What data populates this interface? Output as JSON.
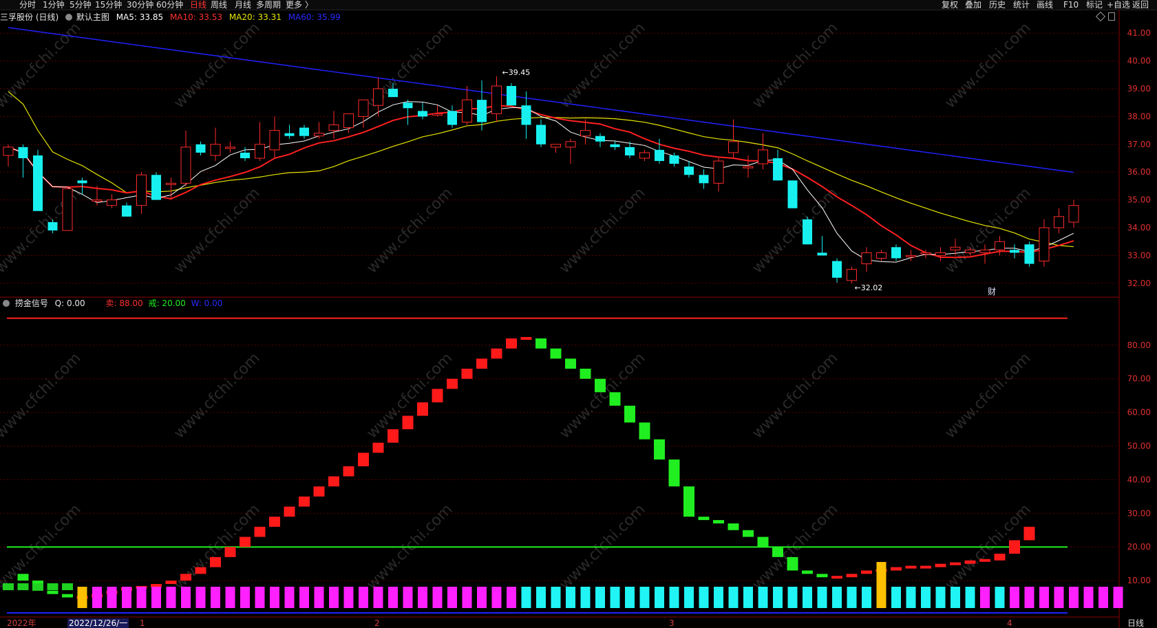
{
  "toolbar": {
    "periods": [
      "分时",
      "1分钟",
      "5分钟",
      "15分钟",
      "30分钟",
      "60分钟",
      "日线",
      "周线",
      "月线",
      "多周期",
      "更多"
    ],
    "active_period": "日线",
    "right_buttons": [
      "复权",
      "叠加",
      "历史",
      "统计",
      "画线",
      "F10",
      "标记",
      "+自选",
      "返回"
    ]
  },
  "stock": {
    "title": "三孚股份 (日线)",
    "main_indicator": "默认主图",
    "ma5_label": "MA5: 33.85",
    "ma10_label": "MA10: 33.53",
    "ma20_label": "MA20: 33.31",
    "ma60_label": "MA60: 35.99",
    "high_label": "39.45",
    "low_label": "32.02",
    "fin_marker": "财"
  },
  "indicator": {
    "name": "捞金信号",
    "q_label": "Q: 0.00",
    "sell_label": "卖: 88.00",
    "buy_label": "戒: 20.00",
    "w_label": "W: 0.00"
  },
  "bottom": {
    "year": "2022年",
    "cursor_date": "2022/12/26/一",
    "months": [
      "1",
      "2",
      "3",
      "4"
    ],
    "period_label": "日线"
  },
  "watermark": "www.cfchi.com",
  "colors": {
    "up": "#ff2a2a",
    "down": "#18f0f0",
    "ma5": "#ffffff",
    "ma10": "#ff2020",
    "ma20": "#e6e600",
    "ma60": "#2020ff",
    "signal_up": "#ff1a1a",
    "signal_down": "#20ee20",
    "magenta": "#ff20ff",
    "cyan": "#20f4f4",
    "gold": "#ffc000",
    "grid": "#5a0000"
  },
  "chart_data": [
    {
      "type": "candlestick",
      "title": "三孚股份 (日线)",
      "y_ticks": [
        "41.00",
        "40.00",
        "39.00",
        "38.00",
        "37.00",
        "36.00",
        "35.00",
        "34.00",
        "33.00",
        "32.00"
      ],
      "ylim": [
        31.6,
        41.5
      ],
      "candles": [
        [
          36.6,
          37.0,
          36.2,
          36.9
        ],
        [
          36.9,
          37.0,
          35.8,
          36.5
        ],
        [
          36.6,
          36.8,
          34.6,
          34.6
        ],
        [
          34.2,
          34.3,
          33.8,
          33.9
        ],
        [
          33.9,
          35.5,
          33.9,
          35.4
        ],
        [
          35.7,
          35.8,
          35.2,
          35.6
        ],
        [
          35.0,
          35.5,
          34.8,
          35.0
        ],
        [
          34.8,
          35.2,
          34.7,
          35.0
        ],
        [
          34.8,
          34.9,
          34.4,
          34.4
        ],
        [
          34.8,
          36.0,
          34.5,
          35.9
        ],
        [
          35.9,
          36.0,
          35.2,
          35.0
        ],
        [
          35.6,
          35.8,
          35.0,
          35.6
        ],
        [
          35.6,
          37.5,
          35.5,
          36.9
        ],
        [
          37.0,
          37.1,
          36.6,
          36.7
        ],
        [
          36.6,
          37.6,
          36.4,
          37.0
        ],
        [
          36.9,
          37.1,
          36.7,
          36.9
        ],
        [
          36.7,
          36.9,
          36.4,
          36.5
        ],
        [
          36.5,
          37.8,
          36.4,
          37.0
        ],
        [
          36.8,
          38.0,
          36.5,
          37.5
        ],
        [
          37.4,
          37.7,
          37.2,
          37.3
        ],
        [
          37.6,
          37.7,
          37.2,
          37.3
        ],
        [
          37.3,
          37.8,
          37.2,
          37.4
        ],
        [
          37.5,
          38.2,
          37.2,
          37.7
        ],
        [
          37.6,
          38.0,
          37.4,
          38.1
        ],
        [
          38.0,
          38.6,
          37.6,
          38.6
        ],
        [
          38.4,
          39.4,
          38.0,
          39.0
        ],
        [
          39.0,
          39.2,
          38.7,
          38.7
        ],
        [
          38.5,
          38.6,
          37.7,
          38.3
        ],
        [
          38.2,
          38.5,
          37.9,
          38.0
        ],
        [
          38.1,
          38.4,
          38.0,
          38.1
        ],
        [
          38.2,
          38.4,
          37.6,
          37.7
        ],
        [
          37.8,
          39.1,
          37.7,
          38.6
        ],
        [
          38.6,
          39.3,
          37.5,
          37.8
        ],
        [
          38.1,
          39.45,
          37.8,
          39.1
        ],
        [
          39.1,
          39.2,
          38.5,
          38.4
        ],
        [
          38.4,
          38.9,
          37.2,
          37.7
        ],
        [
          37.7,
          37.9,
          36.9,
          37.0
        ],
        [
          36.9,
          37.0,
          36.7,
          37.0
        ],
        [
          36.9,
          37.2,
          36.3,
          37.1
        ],
        [
          37.3,
          37.9,
          37.0,
          37.5
        ],
        [
          37.3,
          37.4,
          36.9,
          37.1
        ],
        [
          37.0,
          37.1,
          36.8,
          36.9
        ],
        [
          36.9,
          37.1,
          36.5,
          36.6
        ],
        [
          36.5,
          36.8,
          36.4,
          36.7
        ],
        [
          36.8,
          37.2,
          36.3,
          36.4
        ],
        [
          36.6,
          36.7,
          36.2,
          36.3
        ],
        [
          36.2,
          36.4,
          35.8,
          35.9
        ],
        [
          35.9,
          36.1,
          35.4,
          35.6
        ],
        [
          35.6,
          36.5,
          35.3,
          36.4
        ],
        [
          36.7,
          37.9,
          36.5,
          37.1
        ],
        [
          36.2,
          36.6,
          35.8,
          36.2
        ],
        [
          36.3,
          37.4,
          36.1,
          36.8
        ],
        [
          36.5,
          36.8,
          35.7,
          35.7
        ],
        [
          35.7,
          35.7,
          34.7,
          34.7
        ],
        [
          34.3,
          34.4,
          33.4,
          33.4
        ],
        [
          33.1,
          33.7,
          33.0,
          33.0
        ],
        [
          32.8,
          32.9,
          32.02,
          32.2
        ],
        [
          32.1,
          32.6,
          32.0,
          32.5
        ],
        [
          32.7,
          33.3,
          32.4,
          33.1
        ],
        [
          32.9,
          33.2,
          32.8,
          33.1
        ],
        [
          33.3,
          33.4,
          32.8,
          32.9
        ],
        [
          33.0,
          33.2,
          32.8,
          33.0
        ],
        [
          33.1,
          33.2,
          32.9,
          33.1
        ],
        [
          33.0,
          33.3,
          32.8,
          33.1
        ],
        [
          33.2,
          33.6,
          33.0,
          33.3
        ],
        [
          33.1,
          33.3,
          33.0,
          33.2
        ],
        [
          33.1,
          33.4,
          32.7,
          33.2
        ],
        [
          33.2,
          33.7,
          33.0,
          33.5
        ],
        [
          33.2,
          33.4,
          32.9,
          33.1
        ],
        [
          33.4,
          33.5,
          32.6,
          32.7
        ],
        [
          32.8,
          34.3,
          32.6,
          34.0
        ],
        [
          34.0,
          34.7,
          33.8,
          34.4
        ],
        [
          34.2,
          35.0,
          34.0,
          34.8
        ]
      ]
    },
    {
      "type": "bar",
      "title": "捞金信号",
      "y_ticks": [
        "80.00",
        "70.00",
        "60.00",
        "50.00",
        "40.00",
        "30.00",
        "20.00",
        "10.00"
      ],
      "ylim": [
        0,
        91
      ],
      "lines": {
        "sell": 88,
        "buy": 20
      },
      "signal": [
        12,
        10,
        7,
        6,
        5,
        5,
        6,
        7,
        8,
        8,
        9,
        10,
        12,
        14,
        17,
        20,
        23,
        26,
        29,
        32,
        35,
        38,
        41,
        44,
        48,
        51,
        55,
        59,
        63,
        67,
        70,
        73,
        76,
        79,
        82,
        82,
        79,
        76,
        73,
        70,
        66,
        62,
        57,
        52,
        46,
        38,
        29,
        28,
        27,
        25,
        23,
        20,
        17,
        13,
        12,
        11,
        11,
        12,
        13,
        13,
        14,
        14,
        14,
        15,
        15,
        16,
        16,
        18,
        22,
        26
      ],
      "flags": "GGGGGSGGGGGGGGGGGGGGGGGGGGGGGGGGGGGCCCCCCCCCCCCCCCCCCCCCCCCCCCCCCCGCGGGGGGGG"
    }
  ]
}
